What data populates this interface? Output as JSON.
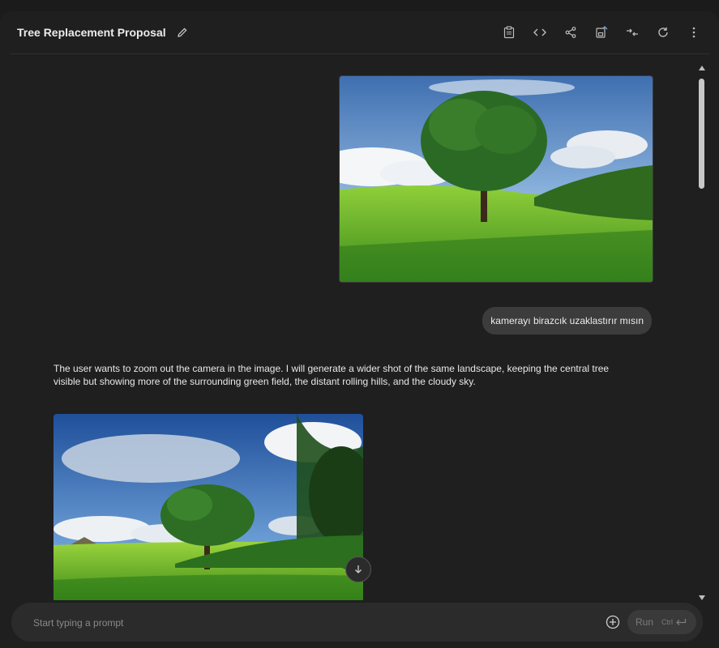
{
  "header": {
    "title": "Tree Replacement Proposal",
    "tools": [
      "copy-prompt-icon",
      "code-icon",
      "share-icon",
      "save-icon",
      "compare-icon",
      "refresh-icon",
      "more-vert-icon"
    ]
  },
  "chat": {
    "user_message": "kamerayı birazcık uzaklastırır mısın",
    "model_text": "The user wants to zoom out the camera in the image. I will generate a wider shot of the same landscape, keeping the central tree visible but showing more of the surrounding green field, the distant rolling hills, and the cloudy sky."
  },
  "prompt": {
    "placeholder": "Start typing a prompt",
    "run_label": "Run",
    "run_hint": "Ctrl"
  },
  "colors": {
    "background": "#1f1f1f",
    "bubble": "#3c3c3c",
    "prompt_bar": "#2b2b2b"
  }
}
